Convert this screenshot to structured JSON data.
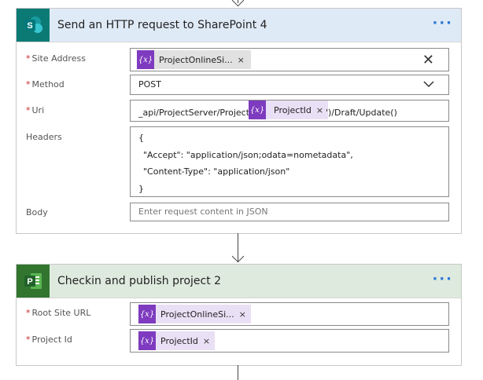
{
  "card1": {
    "title": "Send an HTTP request to SharePoint 4",
    "more": "···",
    "site_address_label": "Site Address",
    "site_token": "ProjectOnlineSi...",
    "method_label": "Method",
    "method_value": "POST",
    "uri_label": "Uri",
    "uri_prefix": "_api/ProjectServer/Projects('",
    "uri_token": "ProjectId",
    "uri_suffix": "')/Draft/Update()",
    "headers_label": "Headers",
    "headers_lines": [
      "{",
      "\"Accept\": \"application/json;odata=nometadata\",",
      "\"Content-Type\": \"application/json\"",
      "}"
    ],
    "body_label": "Body",
    "body_placeholder": "Enter request content in JSON"
  },
  "card2": {
    "title": "Checkin and publish project 2",
    "more": "···",
    "root_label": "Root Site URL",
    "root_token": "ProjectOnlineSi...",
    "project_id_label": "Project Id",
    "project_id_token": "ProjectId"
  },
  "token_icon": "{x}",
  "remove_glyph": "×",
  "colors": {
    "sharepoint": "#0b7a75",
    "project": "#31752f",
    "card1_header_bg": "#dfeaf7",
    "card2_header_bg": "#dfeadf",
    "token_bg": "#eae0f5",
    "token_icon_bg": "#7e3bbf",
    "accent": "#2b79d6"
  }
}
